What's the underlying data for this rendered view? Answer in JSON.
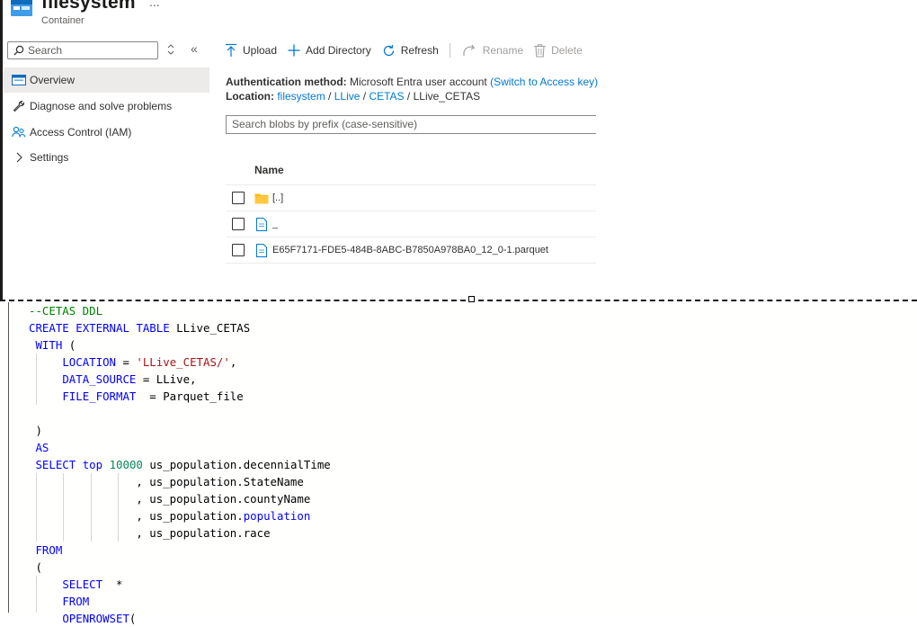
{
  "header": {
    "title": "filesystem",
    "subtitle": "Container",
    "more": "..."
  },
  "sidebar": {
    "search_placeholder": "Search",
    "collapse_glyph": "«",
    "items": [
      {
        "label": "Overview",
        "icon": "overview-icon",
        "active": true
      },
      {
        "label": "Diagnose and solve problems",
        "icon": "wrench-icon"
      },
      {
        "label": "Access Control (IAM)",
        "icon": "people-icon"
      },
      {
        "label": "Settings",
        "icon": "chevron-right-icon"
      }
    ]
  },
  "toolbar": {
    "upload": "Upload",
    "add_directory": "Add Directory",
    "refresh": "Refresh",
    "rename": "Rename",
    "delete": "Delete"
  },
  "info": {
    "auth_label": "Authentication method:",
    "auth_value": "Microsoft Entra user account",
    "auth_switch": "(Switch to Access key)",
    "location_label": "Location:",
    "crumbs": [
      "filesystem",
      "LLive",
      "CETAS",
      "LLive_CETAS"
    ],
    "crumb_sep": "/"
  },
  "blobs": {
    "search_placeholder": "Search blobs by prefix (case-sensitive)",
    "column_name": "Name",
    "rows": [
      {
        "name": "[..]",
        "type": "folder"
      },
      {
        "name": "_",
        "type": "file"
      },
      {
        "name": "E65F7171-FDE5-484B-8ABC-B7850A978BA0_12_0-1.parquet",
        "type": "file"
      }
    ]
  },
  "editor": {
    "lines": [
      "--CETAS DDL",
      "CREATE EXTERNAL TABLE LLive_CETAS",
      " WITH (",
      "     LOCATION = 'LLive_CETAS/',",
      "     DATA_SOURCE = LLive,",
      "     FILE_FORMAT  = Parquet_file",
      "",
      " )",
      " AS",
      " SELECT top 10000 us_population.decennialTime",
      "                , us_population.StateName",
      "                , us_population.countyName",
      "                , us_population.population",
      "                , us_population.race",
      " FROM",
      " (",
      "     SELECT  *",
      "     FROM",
      "     OPENROWSET("
    ]
  },
  "colors": {
    "keyword": "#0000ff",
    "comment": "#008000",
    "string": "#a31515",
    "number": "#098658",
    "link": "#0078d4",
    "folder": "#ffb900"
  }
}
